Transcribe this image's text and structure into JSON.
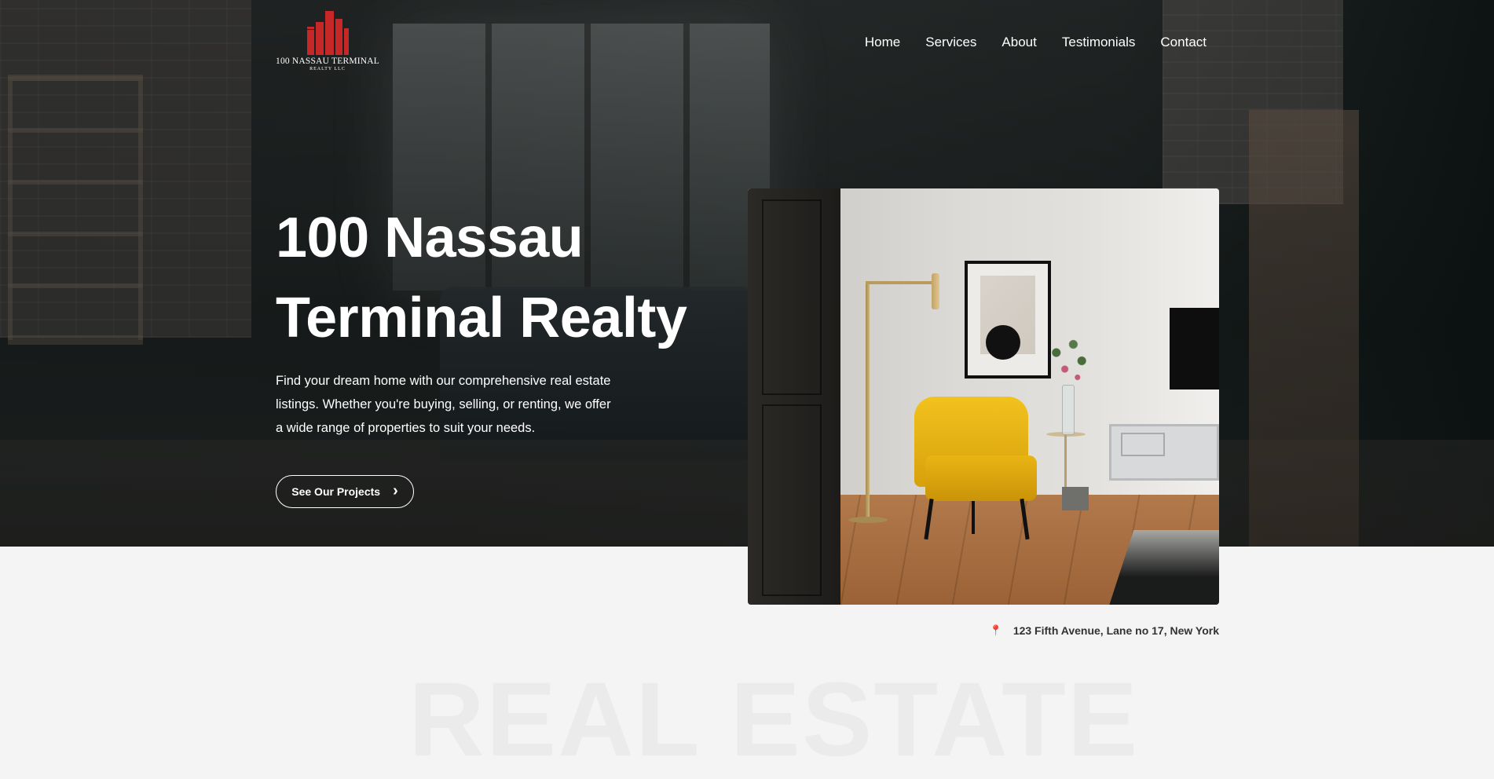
{
  "brand": {
    "name": "100 NASSAU TERMINAL",
    "sub": "REALTY LLC",
    "logo_color": "#c62828",
    "logo_icon": "buildings-icon"
  },
  "nav": {
    "items": [
      {
        "label": "Home"
      },
      {
        "label": "Services"
      },
      {
        "label": "About"
      },
      {
        "label": "Testimonials"
      },
      {
        "label": "Contact"
      }
    ]
  },
  "hero": {
    "title": "100 Nassau Terminal Realty",
    "description": "Find your dream home with our comprehensive real estate listings. Whether you're buying, selling, or renting, we offer a wide range of properties to suit your needs.",
    "cta_label": "See Our Projects",
    "cta_icon": "chevron-right-icon"
  },
  "address": {
    "icon": "map-pin-icon",
    "text": "123 Fifth Avenue, Lane no 17, New York"
  },
  "watermark": {
    "text": "REAL ESTATE"
  }
}
